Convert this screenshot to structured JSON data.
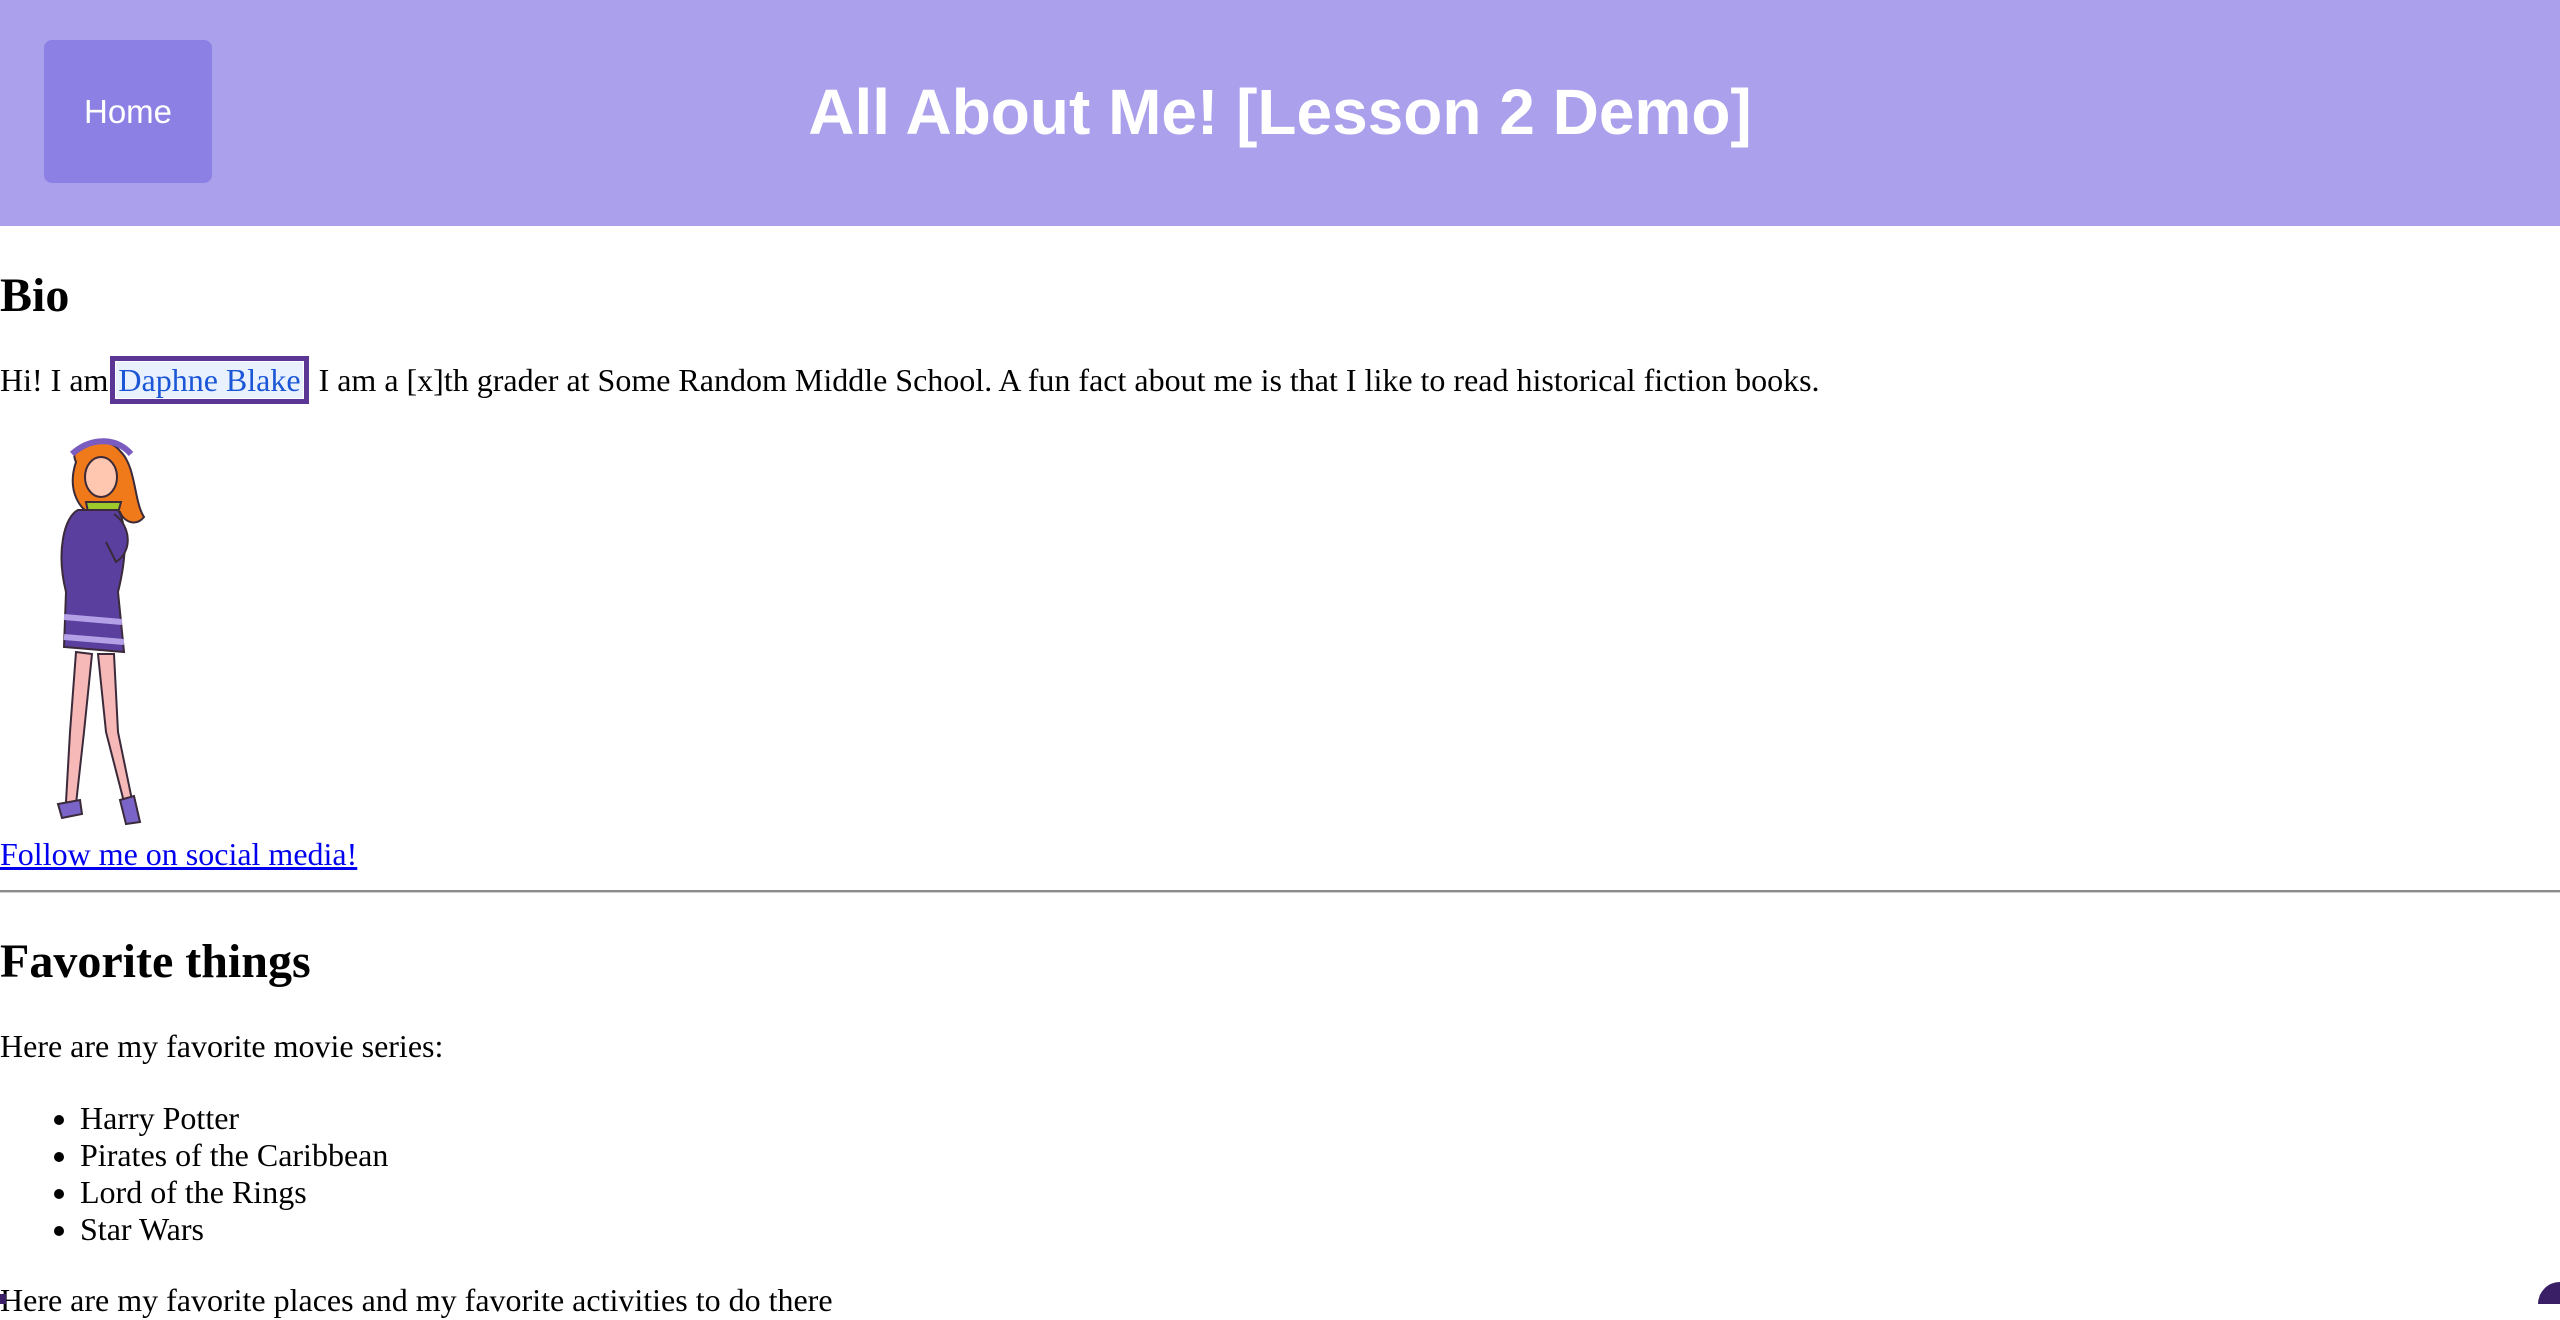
{
  "header": {
    "home_label": "Home",
    "title": "All About Me! [Lesson 2 Demo]"
  },
  "bio": {
    "heading": "Bio",
    "text_before": "Hi! I am ",
    "name": "Daphne Blake",
    "text_after": ". I am a [x]th grader at Some Random Middle School. A fun fact about me is that I like to read historical fiction books.",
    "social_link": "Follow me on social media!"
  },
  "favorites": {
    "heading": "Favorite things",
    "movies_intro": "Here are my favorite movie series:",
    "movies": [
      "Harry Potter",
      "Pirates of the Caribbean",
      "Lord of the Rings",
      "Star Wars"
    ],
    "places_intro": "Here are my favorite places and my favorite activities to do there"
  },
  "colors": {
    "header_bg": "#aba0ec",
    "home_button_bg": "#8c80e4",
    "link": "#0000ee",
    "focus_outline": "#5b3694"
  }
}
